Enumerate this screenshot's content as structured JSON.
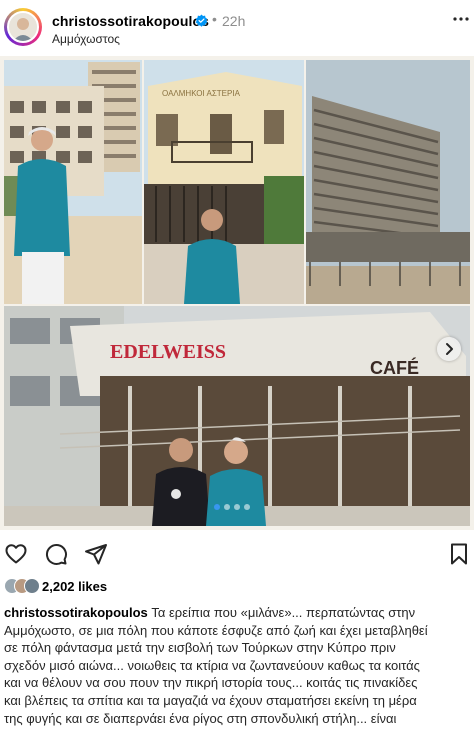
{
  "post": {
    "username": "christossotirakopoulos",
    "verified": true,
    "separator": "•",
    "time": "22h",
    "location": "Αμμόχωστος",
    "more_icon": "more-horizontal-icon"
  },
  "media": {
    "sign_text": "EDELWEISS",
    "cafe_text": "CAFÉ",
    "building_sign": "ΟΑΛΜΗΚΟΙ ΑΣΤΕΡΙΑ",
    "carousel_count": 4,
    "carousel_active": 1
  },
  "actions": {
    "like_icon": "heart-icon",
    "comment_icon": "comment-icon",
    "share_icon": "send-icon",
    "save_icon": "bookmark-icon"
  },
  "likes": {
    "label": "2,202 likes"
  },
  "caption": {
    "username": "christossotirakopoulos",
    "lines": [
      "Τα ερείπια που «μιλάνε»... περπατώντας στην",
      "Αμμόχωστο, σε μια πόλη που κάποτε έσφυζε από ζωή και έχει μεταβληθεί",
      "σε πόλη φάντασμα μετά την εισβολή των Τούρκων στην Κύπρο πριν",
      "σχεδόν μισό αιώνα... νοιωθεις τα κτίρια να ζωντανεύουν καθως τα κοιτάς",
      "και να θέλουν να σου πουν την πικρή ιστορία τους... κοιτάς τις πινακίδες",
      "και βλέπεις τα σπίτια και τα μαγαζιά να έχουν σταματήσει εκείνη τη μέρα",
      "της φυγής και σε διαπερνάει ένα ρίγος στη σπονδυλική στήλη... είναι"
    ]
  },
  "colors": {
    "verified": "#0095f6",
    "active_dot": "#3897f0",
    "muted_text": "#8e8e8e"
  }
}
